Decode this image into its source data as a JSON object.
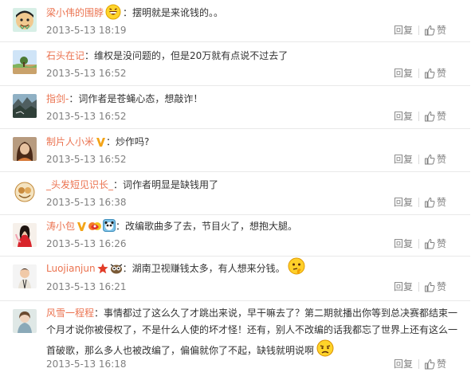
{
  "comments": [
    {
      "user": "梁小伟的围脖",
      "text": "摆明就是来讹钱的。。",
      "time": "2013-5-13 18:19",
      "badges": [],
      "pre_emoji": "grin-face-emoji",
      "post_emoji": null
    },
    {
      "user": "石头在记",
      "text": "维权是没问题的，但是20万就有点说不过去了",
      "time": "2013-5-13 16:52",
      "badges": [],
      "pre_emoji": null,
      "post_emoji": null
    },
    {
      "user": "指剑-",
      "text": "词作者是苍蝇心态，想敲诈！",
      "time": "2013-5-13 16:52",
      "badges": [],
      "pre_emoji": null,
      "post_emoji": null
    },
    {
      "user": "制片人小米",
      "text": "炒作吗?",
      "time": "2013-5-13 16:52",
      "badges": [
        "verified-v-icon"
      ],
      "pre_emoji": null,
      "post_emoji": null
    },
    {
      "user": "_头发短见识长_",
      "text": "词作者明显是缺钱用了",
      "time": "2013-5-13 16:38",
      "badges": [],
      "pre_emoji": null,
      "post_emoji": null
    },
    {
      "user": "涛小包",
      "text": "改编歌曲多了去，节目火了，想抱大腿。",
      "time": "2013-5-13 16:26",
      "badges": [
        "verified-v-icon",
        "couple-icon",
        "panda-icon"
      ],
      "pre_emoji": null,
      "post_emoji": null
    },
    {
      "user": "Luojianjun",
      "text": "湖南卫视赚钱太多，有人想来分钱。",
      "time": "2013-5-13 16:21",
      "badges": [
        "star-icon",
        "owl-icon"
      ],
      "pre_emoji": null,
      "post_emoji": "thinking-face-emoji"
    },
    {
      "user": "风雪一程程",
      "text_lines": [
        "事情都过了这么久了才跳出来说，早干嘛去了？第二期就播出你等到总决赛都结束一",
        "个月才说你被侵权了，不是什么人使的坏才怪！还有，别人不改编的话我都忘了世界上还有这么一",
        "首破歌，那么多人也被改编了，偏偏就你了不起，缺钱就明说啊"
      ],
      "time": "2013-5-13 16:18",
      "badges": [],
      "pre_emoji": null,
      "post_emoji": "grumpy-face-emoji"
    }
  ],
  "actions": {
    "reply_label": "回复",
    "like_label": "赞"
  },
  "colors": {
    "username": "#eb7350",
    "meta": "#808080",
    "divider": "#e9e9e9"
  }
}
